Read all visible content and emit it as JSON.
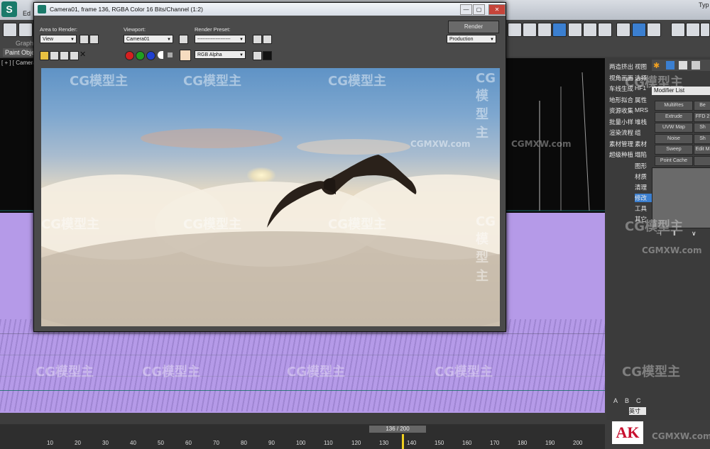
{
  "app": {
    "logo_text": "S",
    "menu_fragment": "Ed",
    "graphite_tab": "Graphi",
    "paint_tab": "Paint Obje",
    "search_fragment": "Typ",
    "viewport_label": "[ + ] [ Camera0"
  },
  "render_window": {
    "title": "Camera01, frame 136, RGBA Color 16 Bits/Channel (1:2)",
    "controls": {
      "minimize": "—",
      "maximize": "▢",
      "close": "✕"
    },
    "area_label": "Area to Render:",
    "area_value": "View",
    "viewport_label": "Viewport:",
    "viewport_value": "Camera01",
    "preset_label": "Render Preset:",
    "preset_value": "--------------------",
    "render_button": "Render",
    "production_value": "Production",
    "channel_value": "RGB Alpha",
    "channel_colors": {
      "red": "#d42020",
      "green": "#20a020",
      "blue": "#2040d0"
    }
  },
  "watermark": {
    "brand": "CG模型主",
    "site": "CGMXW.com"
  },
  "command_panel": {
    "cn_items": [
      "两造挤出",
      "视角画面",
      "车线生成",
      "地形拟合",
      "资源收集",
      "批量小样",
      "渲染流程",
      "素材管理",
      "超级种植"
    ],
    "cn_items_col2": [
      "视图",
      "选择",
      "HF1",
      "属性",
      "MRS",
      "堆栈",
      "组",
      "素材",
      "塌陷"
    ],
    "cn_items_col3": [
      "图形",
      "材质",
      "清理",
      "修改",
      "工具",
      "其它"
    ],
    "modifier_list": "Modifier List",
    "modifier_buttons": [
      "MultiRes",
      "Extrude",
      "UVW Map",
      "Noise",
      "Sweep",
      "Point Cache"
    ],
    "modifier_buttons_col2": [
      "Be",
      "FFD 2",
      "Sh",
      "Sh",
      "Edit M",
      ""
    ],
    "abc_labels": [
      "A",
      "B",
      "C"
    ],
    "unit_label": "英寸"
  },
  "timeline": {
    "frame_counter": "136 / 200",
    "ticks": [
      "10",
      "20",
      "30",
      "40",
      "50",
      "60",
      "70",
      "80",
      "90",
      "100",
      "110",
      "120",
      "130",
      "140",
      "150",
      "160",
      "170",
      "180",
      "190",
      "200"
    ]
  },
  "logo": {
    "text": "AK"
  }
}
